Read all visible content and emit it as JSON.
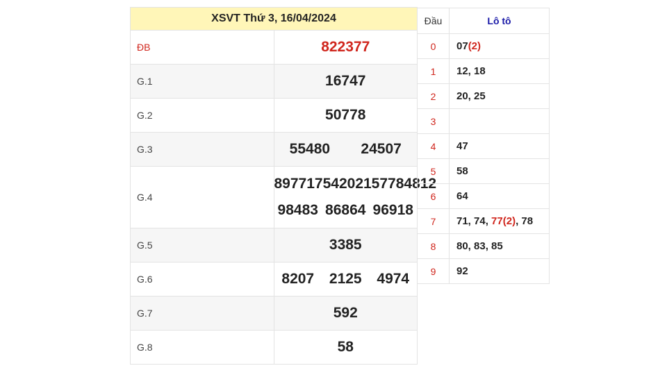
{
  "results": {
    "title": "XSVT Thứ 3, 16/04/2024",
    "prizes": [
      {
        "label": "ĐB",
        "numbers": [
          "822377"
        ]
      },
      {
        "label": "G.1",
        "numbers": [
          "16747"
        ]
      },
      {
        "label": "G.2",
        "numbers": [
          "50778"
        ]
      },
      {
        "label": "G.3",
        "numbers": [
          "55480",
          "24507"
        ]
      },
      {
        "label": "G.4",
        "numbers": [
          "89771",
          "75420",
          "21577",
          "84812",
          "98483",
          "86864",
          "96918"
        ]
      },
      {
        "label": "G.5",
        "numbers": [
          "3385"
        ]
      },
      {
        "label": "G.6",
        "numbers": [
          "8207",
          "2125",
          "4974"
        ]
      },
      {
        "label": "G.7",
        "numbers": [
          "592"
        ]
      },
      {
        "label": "G.8",
        "numbers": [
          "58"
        ]
      }
    ]
  },
  "loto": {
    "header_head": "Đầu",
    "header_tail": "Lô tô",
    "rows": [
      {
        "head": "0",
        "tails_html_parts": [
          {
            "t": "07"
          },
          {
            "t": "(2)",
            "red": true
          }
        ]
      },
      {
        "head": "1",
        "tails_html_parts": [
          {
            "t": "12, 18"
          }
        ]
      },
      {
        "head": "2",
        "tails_html_parts": [
          {
            "t": "20, 25"
          }
        ]
      },
      {
        "head": "3",
        "tails_html_parts": []
      },
      {
        "head": "4",
        "tails_html_parts": [
          {
            "t": "47"
          }
        ]
      },
      {
        "head": "5",
        "tails_html_parts": [
          {
            "t": "58"
          }
        ]
      },
      {
        "head": "6",
        "tails_html_parts": [
          {
            "t": "64"
          }
        ]
      },
      {
        "head": "7",
        "tails_html_parts": [
          {
            "t": "71, 74, "
          },
          {
            "t": "77(2)",
            "red": true
          },
          {
            "t": ", 78"
          }
        ]
      },
      {
        "head": "8",
        "tails_html_parts": [
          {
            "t": "80, 83, 85"
          }
        ]
      },
      {
        "head": "9",
        "tails_html_parts": [
          {
            "t": "92"
          }
        ]
      }
    ]
  }
}
